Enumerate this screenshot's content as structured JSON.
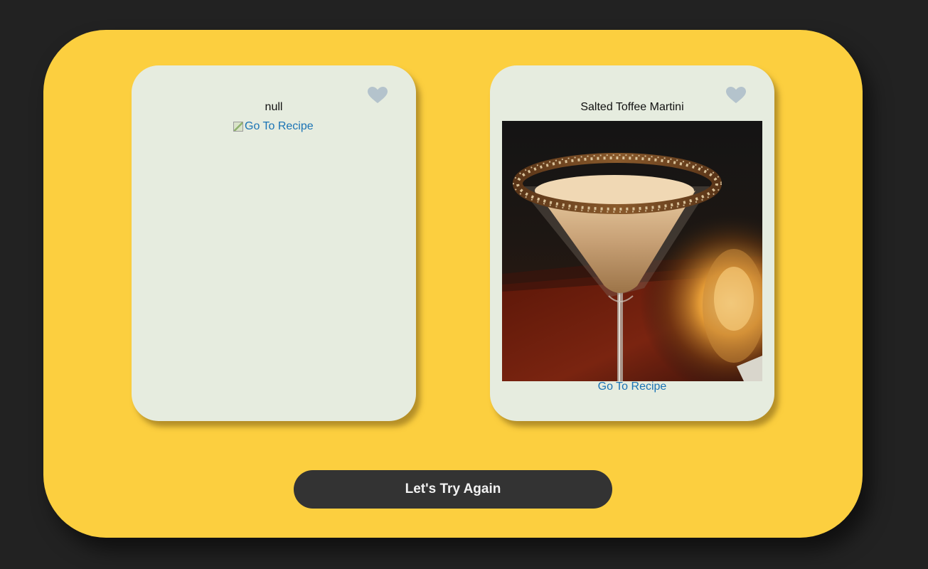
{
  "cards": [
    {
      "title": "null",
      "link_label": "Go To Recipe",
      "image_loaded": false,
      "heart_icon": "heart-icon"
    },
    {
      "title": "Salted Toffee Martini",
      "link_label": "Go To Recipe",
      "image_loaded": true,
      "image_description": "martini glass with toffee-rimmed cocktail",
      "heart_icon": "heart-icon"
    }
  ],
  "action_button": {
    "label": "Let's Try Again"
  },
  "colors": {
    "page_background": "#222222",
    "panel": "#fccf3f",
    "card": "#e6ecdf",
    "heart": "#b4c3cc",
    "link": "#1a73b5",
    "button": "#333333",
    "button_text": "#f2f2f2"
  }
}
